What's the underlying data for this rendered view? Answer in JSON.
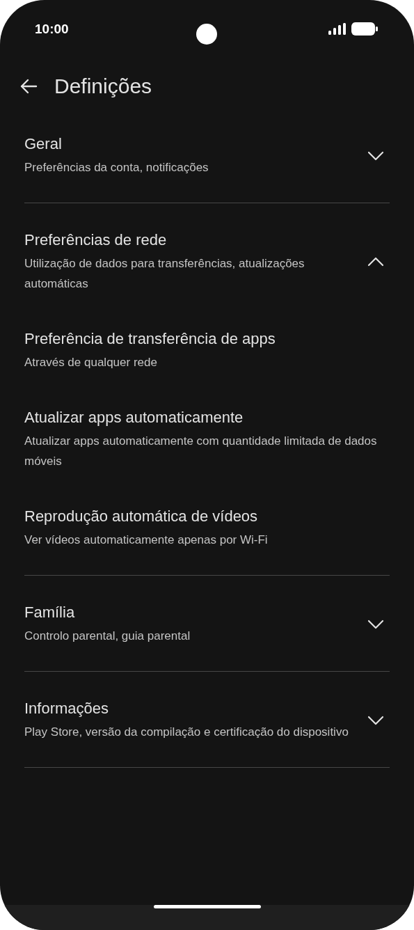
{
  "status_bar": {
    "time": "10:00"
  },
  "header": {
    "title": "Definições"
  },
  "sections": [
    {
      "title": "Geral",
      "subtitle": "Preferências da conta, notificações",
      "expanded": false
    },
    {
      "title": "Preferências de rede",
      "subtitle": "Utilização de dados para transferências, atualizações automáticas",
      "expanded": true,
      "children": [
        {
          "title": "Preferência de transferência de apps",
          "subtitle": "Através de qualquer rede"
        },
        {
          "title": "Atualizar apps automaticamente",
          "subtitle": "Atualizar apps automaticamente com quantidade limitada de dados móveis"
        },
        {
          "title": "Reprodução automática de vídeos",
          "subtitle": "Ver vídeos automaticamente apenas por Wi-Fi"
        }
      ]
    },
    {
      "title": "Família",
      "subtitle": "Controlo parental, guia parental",
      "expanded": false
    },
    {
      "title": "Informações",
      "subtitle": "Play Store, versão da compilação e certificação do dispositivo",
      "expanded": false
    }
  ]
}
